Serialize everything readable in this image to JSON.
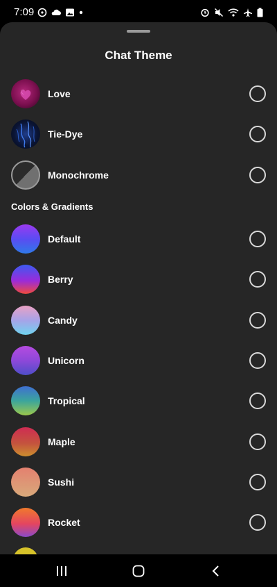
{
  "status_bar": {
    "time": "7:09",
    "left_icons": [
      "reminder-icon",
      "cloud-icon",
      "gallery-icon",
      "dot-icon"
    ],
    "right_icons": [
      "alarm-icon",
      "mute-icon",
      "wifi-icon",
      "airplane-icon",
      "battery-icon"
    ]
  },
  "sheet": {
    "title": "Chat Theme"
  },
  "themes_top": [
    {
      "name": "Love",
      "swatch": "love",
      "selected": false
    },
    {
      "name": "Tie-Dye",
      "swatch": "tiedye",
      "selected": false
    },
    {
      "name": "Monochrome",
      "swatch": "mono",
      "selected": false
    }
  ],
  "section": {
    "colors_gradients": "Colors & Gradients"
  },
  "themes_colors": [
    {
      "name": "Default",
      "swatch": "default",
      "selected": false
    },
    {
      "name": "Berry",
      "swatch": "berry",
      "selected": false
    },
    {
      "name": "Candy",
      "swatch": "candy",
      "selected": false
    },
    {
      "name": "Unicorn",
      "swatch": "unicorn",
      "selected": false
    },
    {
      "name": "Tropical",
      "swatch": "tropical",
      "selected": false
    },
    {
      "name": "Maple",
      "swatch": "maple",
      "selected": false
    },
    {
      "name": "Sushi",
      "swatch": "sushi",
      "selected": false
    },
    {
      "name": "Rocket",
      "swatch": "rocket",
      "selected": false
    }
  ],
  "nav": {
    "icons": [
      "recent-apps-icon",
      "home-icon",
      "back-icon"
    ]
  },
  "colors": {
    "background": "#000000",
    "sheet": "#262626",
    "text": "#ffffff",
    "radio_outline": "#d9d9d9"
  }
}
